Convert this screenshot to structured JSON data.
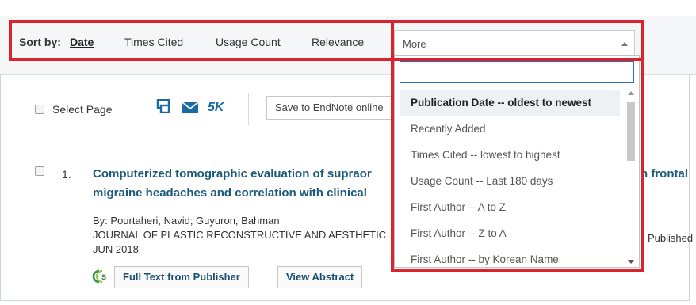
{
  "sort": {
    "label": "Sort by:",
    "date": "Date",
    "times_cited": "Times Cited",
    "usage_count": "Usage Count",
    "relevance": "Relevance",
    "more": {
      "selected": "More",
      "search_value": "",
      "options": [
        "Publication Date -- oldest to newest",
        "Recently Added",
        "Times Cited -- lowest to highest",
        "Usage Count -- Last 180 days",
        "First Author -- A to Z",
        "First Author -- Z to A",
        "First Author -- by Korean Name"
      ],
      "highlighted_index": 0
    }
  },
  "toolbar": {
    "select_page": "Select Page",
    "icons": [
      "print-icon",
      "email-icon"
    ],
    "count": "5K",
    "endnote_label": "Save to EndNote online"
  },
  "record": {
    "number": "1.",
    "title": "Computerized tomographic evaluation of supraor migraine headaches and correlation with clinical",
    "title_right": "h frontal",
    "authors": "By: Pourtaheri, Navid; Guyuron, Bahman",
    "journal": "JOURNAL OF PLASTIC RECONSTRUCTIVE AND AESTHETIC",
    "date": "JUN 2018",
    "published_label": "Published",
    "full_text_button": "Full Text from Publisher",
    "abstract_button": "View Abstract"
  },
  "colors": {
    "highlight_box": "#d9232d",
    "title_link": "#1b5a7e",
    "accent": "#1a6aa3"
  }
}
